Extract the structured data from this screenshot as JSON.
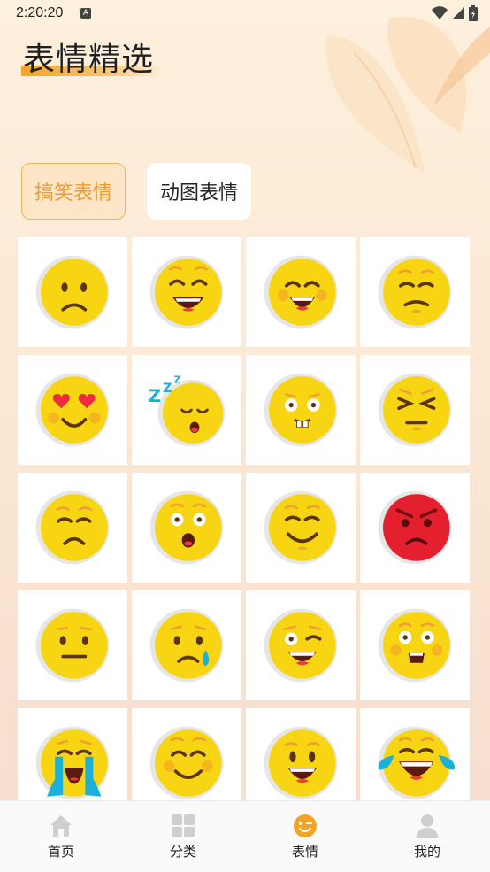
{
  "status_bar": {
    "time": "2:20:20",
    "notification": "A"
  },
  "page_title": "表情精选",
  "tabs": [
    {
      "label": "搞笑表情",
      "active": true
    },
    {
      "label": "动图表情",
      "active": false
    }
  ],
  "emojis": [
    "sad-face-icon",
    "grinning-face-icon",
    "laughing-face-icon",
    "smirking-face-icon",
    "heart-eyes-face-icon",
    "sleeping-face-icon",
    "buck-tooth-face-icon",
    "squinting-face-icon",
    "pensive-face-icon",
    "surprised-face-icon",
    "smiling-face-icon",
    "angry-red-face-icon",
    "neutral-face-icon",
    "sad-tear-face-icon",
    "winking-face-icon",
    "astonished-face-icon",
    "crying-face-icon",
    "blushing-face-icon",
    "happy-face-icon",
    "tears-of-joy-face-icon"
  ],
  "nav": [
    {
      "label": "首页",
      "icon": "home-icon",
      "active": false
    },
    {
      "label": "分类",
      "icon": "grid-icon",
      "active": false
    },
    {
      "label": "表情",
      "icon": "wink-icon",
      "active": true
    },
    {
      "label": "我的",
      "icon": "user-icon",
      "active": false
    }
  ],
  "colors": {
    "accent": "#f4a425",
    "emoji_yellow": "#f7d512",
    "angry_red": "#e4202f"
  }
}
